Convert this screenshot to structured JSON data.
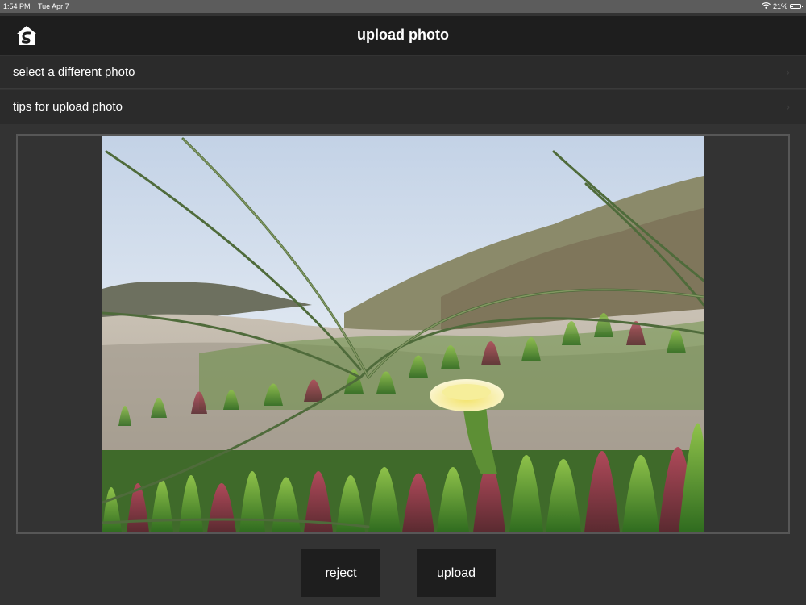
{
  "status_bar": {
    "time": "1:54 PM",
    "date": "Tue Apr 7",
    "battery": "21%",
    "battery_level": 0.21,
    "wifi_icon": "wifi-icon"
  },
  "nav": {
    "title": "upload photo",
    "home_icon": "home-logo-icon"
  },
  "menu": {
    "items": [
      {
        "label": "select a different photo"
      },
      {
        "label": "tips for upload photo"
      }
    ]
  },
  "photo": {
    "subject": "yellow flower among green succulents with dune grass"
  },
  "actions": {
    "reject_label": "reject",
    "upload_label": "upload"
  },
  "colors": {
    "background": "#333333",
    "nav_bar": "#1e1e1e",
    "row_background": "#2b2b2b",
    "button_background": "#1e1e1e",
    "text": "#ffffff"
  }
}
